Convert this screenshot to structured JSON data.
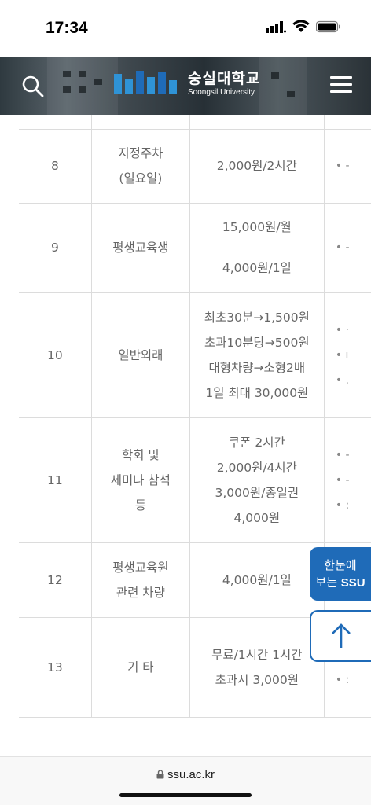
{
  "status": {
    "time": "17:34"
  },
  "header": {
    "logo_kr": "숭실대학교",
    "logo_en": "Soongsil University"
  },
  "table": {
    "rows": [
      {
        "no": "8",
        "category": [
          "지정주차",
          "(일요일)"
        ],
        "fee": [
          "2,000원/2시간"
        ],
        "notes": [
          "• -"
        ]
      },
      {
        "no": "9",
        "category": [
          "평생교육생"
        ],
        "fee": [
          "15,000원/월",
          "",
          "4,000원/1일"
        ],
        "notes": [
          "• -"
        ]
      },
      {
        "no": "10",
        "category": [
          "일반외래"
        ],
        "fee": [
          "최초30분→1,500원",
          "초과10분당→500원",
          "대형차량→소형2배",
          "1일 최대 30,000원"
        ],
        "notes": [
          "• ·",
          "• ı",
          "• ."
        ]
      },
      {
        "no": "11",
        "category": [
          "학회 및",
          "세미나 참석",
          "등"
        ],
        "fee": [
          "쿠폰 2시간",
          "2,000원/4시간",
          "3,000원/종일권",
          "4,000원"
        ],
        "notes": [
          "• -",
          "• -",
          "• :"
        ]
      },
      {
        "no": "12",
        "category": [
          "평생교육원",
          "관련 차량"
        ],
        "fee": [
          "4,000원/1일"
        ],
        "notes": []
      },
      {
        "no": "13",
        "category": [
          "기 타"
        ],
        "fee": [
          "무료/1시간 1시간",
          "초과시 3,000원"
        ],
        "notes": [
          "• /",
          "• :"
        ]
      }
    ]
  },
  "floating": {
    "summary_line1": "한눈에",
    "summary_line2a": "보는 ",
    "summary_line2b": "SSU"
  },
  "browser": {
    "url": "ssu.ac.kr"
  },
  "colors": {
    "accent": "#1f6bb8"
  }
}
